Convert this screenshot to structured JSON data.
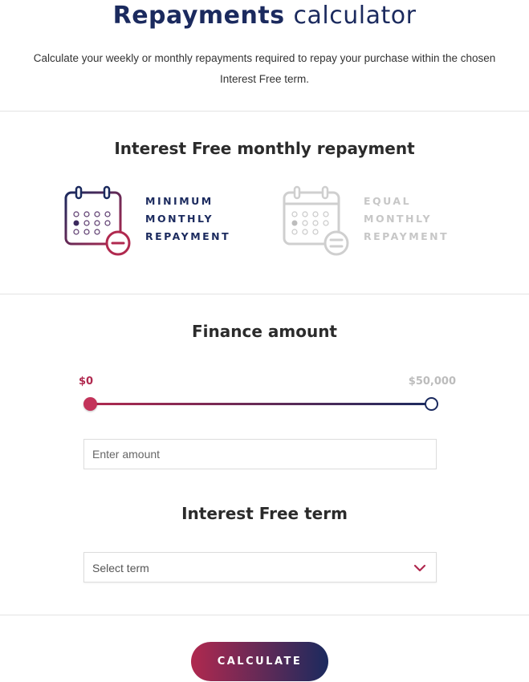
{
  "header": {
    "title_bold": "Repayments",
    "title_light": "calculator",
    "subtitle": "Calculate your weekly or monthly repayments required to repay your purchase within the chosen Interest Free term."
  },
  "repayment_type": {
    "heading": "Interest Free monthly repayment",
    "options": [
      {
        "label": "MINIMUM MONTHLY REPAYMENT",
        "icon": "calendar-minus-icon",
        "selected": true
      },
      {
        "label": "EQUAL MONTHLY REPAYMENT",
        "icon": "calendar-equals-icon",
        "selected": false
      }
    ]
  },
  "finance": {
    "heading": "Finance amount",
    "min_label": "$0",
    "max_label": "$50,000",
    "amount_placeholder": "Enter amount",
    "amount_value": ""
  },
  "term": {
    "heading": "Interest Free term",
    "selected_value": "Select term"
  },
  "actions": {
    "calculate_label": "CALCULATE"
  },
  "colors": {
    "primary_navy": "#1b2a5e",
    "accent_crimson": "#b0294f",
    "disabled_gray": "#c7c7c7"
  }
}
